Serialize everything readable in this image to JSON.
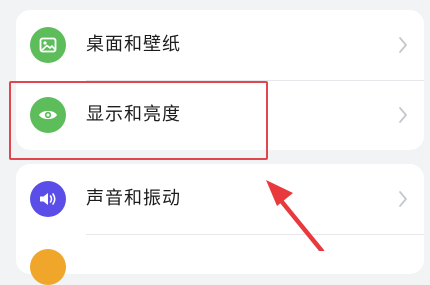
{
  "settings": {
    "items": [
      {
        "label": "桌面和壁纸",
        "icon": "wallpaper-icon",
        "icon_color": "#5cbd5a"
      },
      {
        "label": "显示和亮度",
        "icon": "eye-icon",
        "icon_color": "#5cbd5a"
      },
      {
        "label": "声音和振动",
        "icon": "speaker-icon",
        "icon_color": "#5b4ee8"
      }
    ],
    "next_item_icon_color": "#f0a52b"
  },
  "annotation": {
    "highlight_color": "#e0474c",
    "arrow_color": "#e8393c"
  }
}
